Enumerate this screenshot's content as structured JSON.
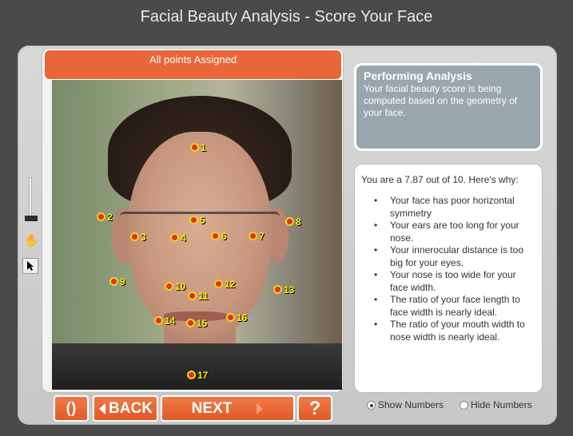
{
  "title": "Facial Beauty Analysis - Score Your Face",
  "status": "All points Assigned",
  "analysis": {
    "title": "Performing Analysis",
    "text": "Your facial beauty score is being computed based on the geometry of your face."
  },
  "results": {
    "summary": "You are a 7.87 out of 10.  Here's why:",
    "items": [
      "Your face has poor horizontal symmetry",
      "Your ears are too long for your nose.",
      "Your innerocular distance is too big for your eyes.",
      "Your nose is too wide for your face width.",
      "The ratio of your face length to face width is nearly ideal.",
      "The ratio of your mouth width to nose width is nearly ideal."
    ]
  },
  "buttons": {
    "reset": "()",
    "back": "BACK",
    "next": "NEXT",
    "help": "?"
  },
  "display_options": {
    "show_numbers": "Show Numbers",
    "hide_numbers": "Hide Numbers",
    "selected": "show_numbers"
  },
  "markers": [
    "1",
    "2",
    "3",
    "4",
    "5",
    "6",
    "7",
    "8",
    "9",
    "10",
    "11",
    "12",
    "13",
    "14",
    "15",
    "16",
    "17"
  ],
  "colors": {
    "accent": "#e8663a",
    "marker_fill": "#e0301e",
    "marker_ring": "#f2d21a",
    "label": "#fff200"
  }
}
